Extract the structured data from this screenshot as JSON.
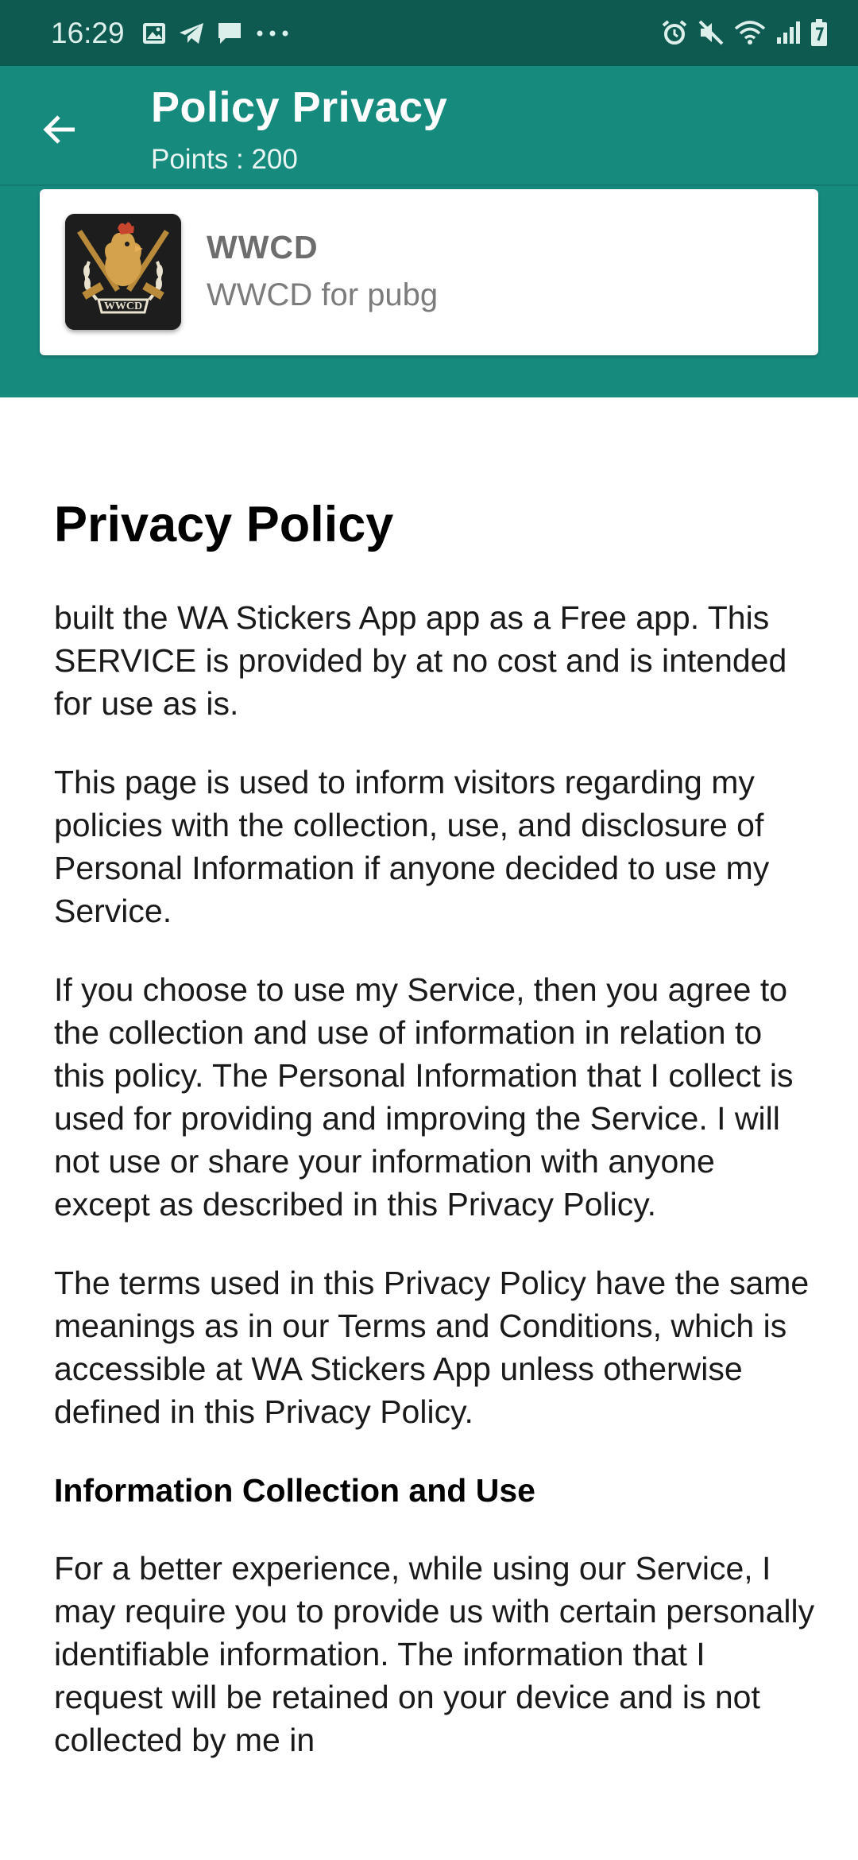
{
  "status_bar": {
    "time": "16:29",
    "icons_left": [
      "gallery-icon",
      "telegram-icon",
      "message-icon",
      "more-dots-icon"
    ],
    "icons_right": [
      "alarm-icon",
      "mute-icon",
      "wifi-icon",
      "signal-icon",
      "battery-icon"
    ]
  },
  "app_bar": {
    "back_icon": "arrow-back-icon",
    "title": "Policy Privacy",
    "subtitle": "Points : 200"
  },
  "pack": {
    "name": "WWCD",
    "description": "WWCD for pubg",
    "badge_text": "WWCD"
  },
  "policy": {
    "heading": "Privacy Policy",
    "paragraphs": [
      "built the WA Stickers App app as a Free app. This SERVICE is provided by at no cost and is intended for use as is.",
      "This page is used to inform visitors regarding my policies with the collection, use, and disclosure of Personal Information if anyone decided to use my Service.",
      "If you choose to use my Service, then you agree to the collection and use of information in relation to this policy. The Personal Information that I collect is used for providing and improving the Service. I will not use or share your information with anyone except as described in this Privacy Policy.",
      "The terms used in this Privacy Policy have the same meanings as in our Terms and Conditions, which is accessible at WA Stickers App unless otherwise defined in this Privacy Policy."
    ],
    "section_heading": "Information Collection and Use",
    "section_paragraph": "For a better experience, while using our Service, I may require you to provide us with certain personally identifiable information. The information that I request will be retained on your device and is not collected by me in"
  },
  "colors": {
    "status_bar": "#0e5a50",
    "app_bar": "#178a7e",
    "card": "#ffffff",
    "text": "#1a1a1a"
  }
}
